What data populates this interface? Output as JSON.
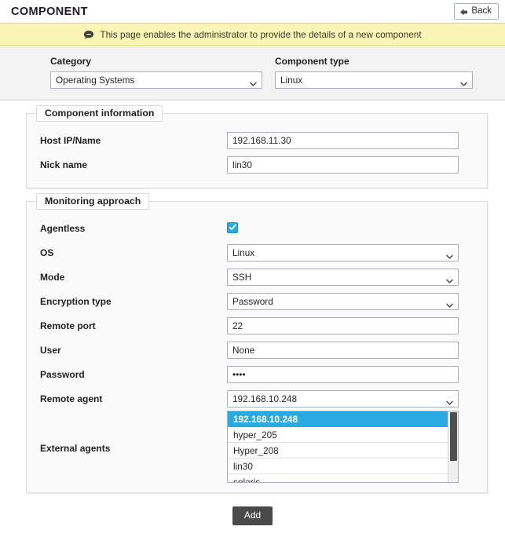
{
  "header": {
    "title": "COMPONENT",
    "back_label": "Back",
    "back_icon": "back-arrow-icon"
  },
  "banner": {
    "icon": "comment-icon",
    "text": "This page enables the administrator to provide the details of a new component"
  },
  "category_strip": {
    "category": {
      "label": "Category",
      "value": "Operating Systems"
    },
    "component_type": {
      "label": "Component type",
      "value": "Linux"
    }
  },
  "component_information": {
    "legend": "Component information",
    "rows": [
      {
        "label": "Host IP/Name",
        "value": "192.168.11.30",
        "type": "text"
      },
      {
        "label": "Nick name",
        "value": "lin30",
        "type": "text"
      }
    ]
  },
  "monitoring_approach": {
    "legend": "Monitoring approach",
    "agentless": {
      "label": "Agentless",
      "checked": true
    },
    "rows": [
      {
        "label": "OS",
        "value": "Linux",
        "type": "select"
      },
      {
        "label": "Mode",
        "value": "SSH",
        "type": "select"
      },
      {
        "label": "Encryption type",
        "value": "Password",
        "type": "select"
      },
      {
        "label": "Remote port",
        "value": "22",
        "type": "text"
      },
      {
        "label": "User",
        "value": "None",
        "type": "text"
      },
      {
        "label": "Password",
        "value": "••••",
        "type": "password"
      },
      {
        "label": "Remote agent",
        "value": "192.168.10.248",
        "type": "select"
      }
    ],
    "external_agents": {
      "label": "External agents",
      "items": [
        {
          "text": "192.168.10.248",
          "selected": true
        },
        {
          "text": "hyper_205",
          "selected": false
        },
        {
          "text": "Hyper_208",
          "selected": false
        },
        {
          "text": "lin30",
          "selected": false
        },
        {
          "text": "solaris",
          "selected": false
        }
      ]
    }
  },
  "footer": {
    "add_label": "Add"
  },
  "colors": {
    "accent": "#29abe2",
    "banner_bg": "#fbf6b6",
    "button_bg": "#4a4a4a"
  }
}
